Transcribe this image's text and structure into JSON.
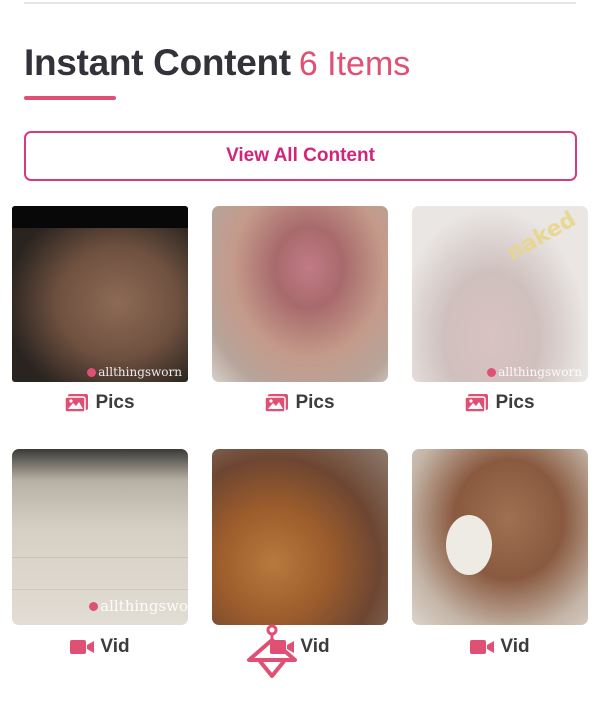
{
  "header": {
    "title": "Instant Content",
    "count": "6 Items"
  },
  "view_all_label": "View All Content",
  "items": [
    {
      "label": "Pics",
      "icon": "image-icon",
      "watermark": "allthingsworn"
    },
    {
      "label": "Pics",
      "icon": "image-icon",
      "watermark": ""
    },
    {
      "label": "Pics",
      "icon": "image-icon",
      "watermark": "allthingsworn"
    },
    {
      "label": "Vid",
      "icon": "video-camera-icon",
      "watermark": "allthingswo"
    },
    {
      "label": "Vid",
      "icon": "video-camera-icon",
      "watermark": ""
    },
    {
      "label": "Vid",
      "icon": "video-camera-icon",
      "watermark": ""
    }
  ],
  "colors": {
    "accent": "#e04f74",
    "button_border": "#d63a83",
    "button_text": "#d1257c",
    "title": "#33323b"
  }
}
